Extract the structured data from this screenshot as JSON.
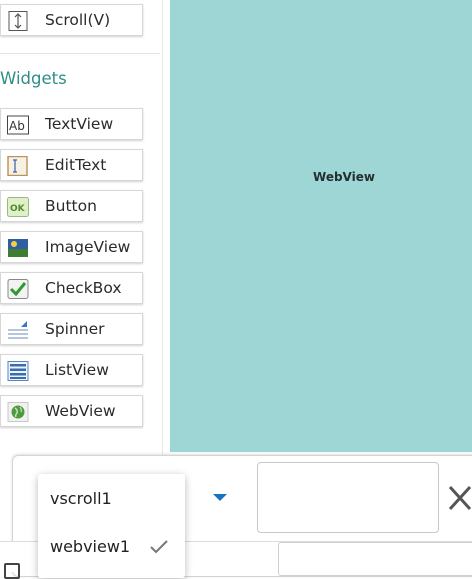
{
  "palette": {
    "scroll_item": {
      "label": "Scroll(V)",
      "icon": "vertical-scroll-icon"
    },
    "section_title": "Widgets",
    "widgets": [
      {
        "label": "TextView",
        "icon": "textview-icon"
      },
      {
        "label": "EditText",
        "icon": "edittext-icon"
      },
      {
        "label": "Button",
        "icon": "button-icon"
      },
      {
        "label": "ImageView",
        "icon": "imageview-icon"
      },
      {
        "label": "CheckBox",
        "icon": "checkbox-icon"
      },
      {
        "label": "Spinner",
        "icon": "spinner-icon"
      },
      {
        "label": "ListView",
        "icon": "listview-icon"
      },
      {
        "label": "WebView",
        "icon": "webview-icon"
      }
    ]
  },
  "canvas": {
    "selected_view_label": "WebView",
    "background": "#9ed6d6"
  },
  "property_panel": {
    "name_value": ""
  },
  "dropdown": {
    "options": [
      {
        "label": "vscroll1",
        "selected": false
      },
      {
        "label": "webview1",
        "selected": true
      }
    ]
  },
  "colors": {
    "accent": "#2f8f86",
    "arrow": "#1a73c2"
  }
}
